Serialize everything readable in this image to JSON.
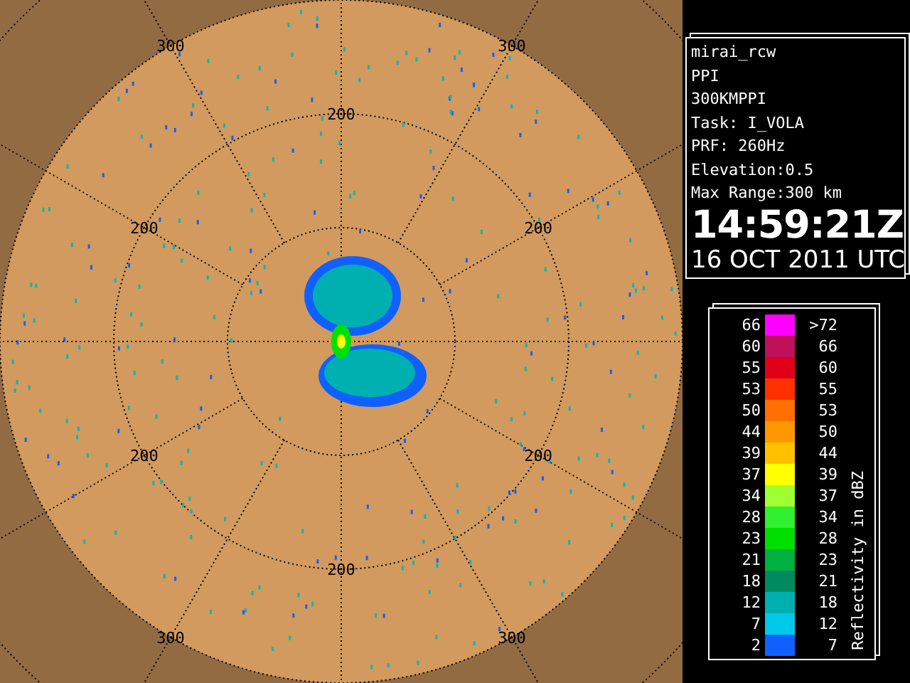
{
  "radar_map": {
    "range_labels": [
      "300",
      "300",
      "200",
      "200",
      "200",
      "200",
      "200",
      "200",
      "300",
      "300"
    ]
  },
  "info": {
    "lines": [
      "mirai_rcw",
      "PPI",
      "300KMPPI",
      "Task: I_VOLA",
      "PRF: 260Hz",
      "Elevation:0.5",
      "Max Range:300 km"
    ],
    "time": "14:59:21Z",
    "date": "16 OCT 2011 UTC"
  },
  "legend": {
    "title": "Reflectivity in dBZ",
    "items": [
      {
        "low": "66",
        "high": ">72",
        "color": "#ff00ff"
      },
      {
        "low": "60",
        "high": "66",
        "color": "#c0105a"
      },
      {
        "low": "55",
        "high": "60",
        "color": "#e00018"
      },
      {
        "low": "53",
        "high": "55",
        "color": "#ff3000"
      },
      {
        "low": "50",
        "high": "53",
        "color": "#ff7000"
      },
      {
        "low": "44",
        "high": "50",
        "color": "#ff9800"
      },
      {
        "low": "39",
        "high": "44",
        "color": "#ffc000"
      },
      {
        "low": "37",
        "high": "39",
        "color": "#ffff00"
      },
      {
        "low": "34",
        "high": "37",
        "color": "#a0ff30"
      },
      {
        "low": "28",
        "high": "34",
        "color": "#30f030"
      },
      {
        "low": "23",
        "high": "28",
        "color": "#00e000"
      },
      {
        "low": "21",
        "high": "23",
        "color": "#00b040"
      },
      {
        "low": "18",
        "high": "21",
        "color": "#008a60"
      },
      {
        "low": "12",
        "high": "18",
        "color": "#00b0b0"
      },
      {
        "low": "7",
        "high": "12",
        "color": "#00c8e8"
      },
      {
        "low": "2",
        "high": "7",
        "color": "#1060ff"
      }
    ]
  }
}
